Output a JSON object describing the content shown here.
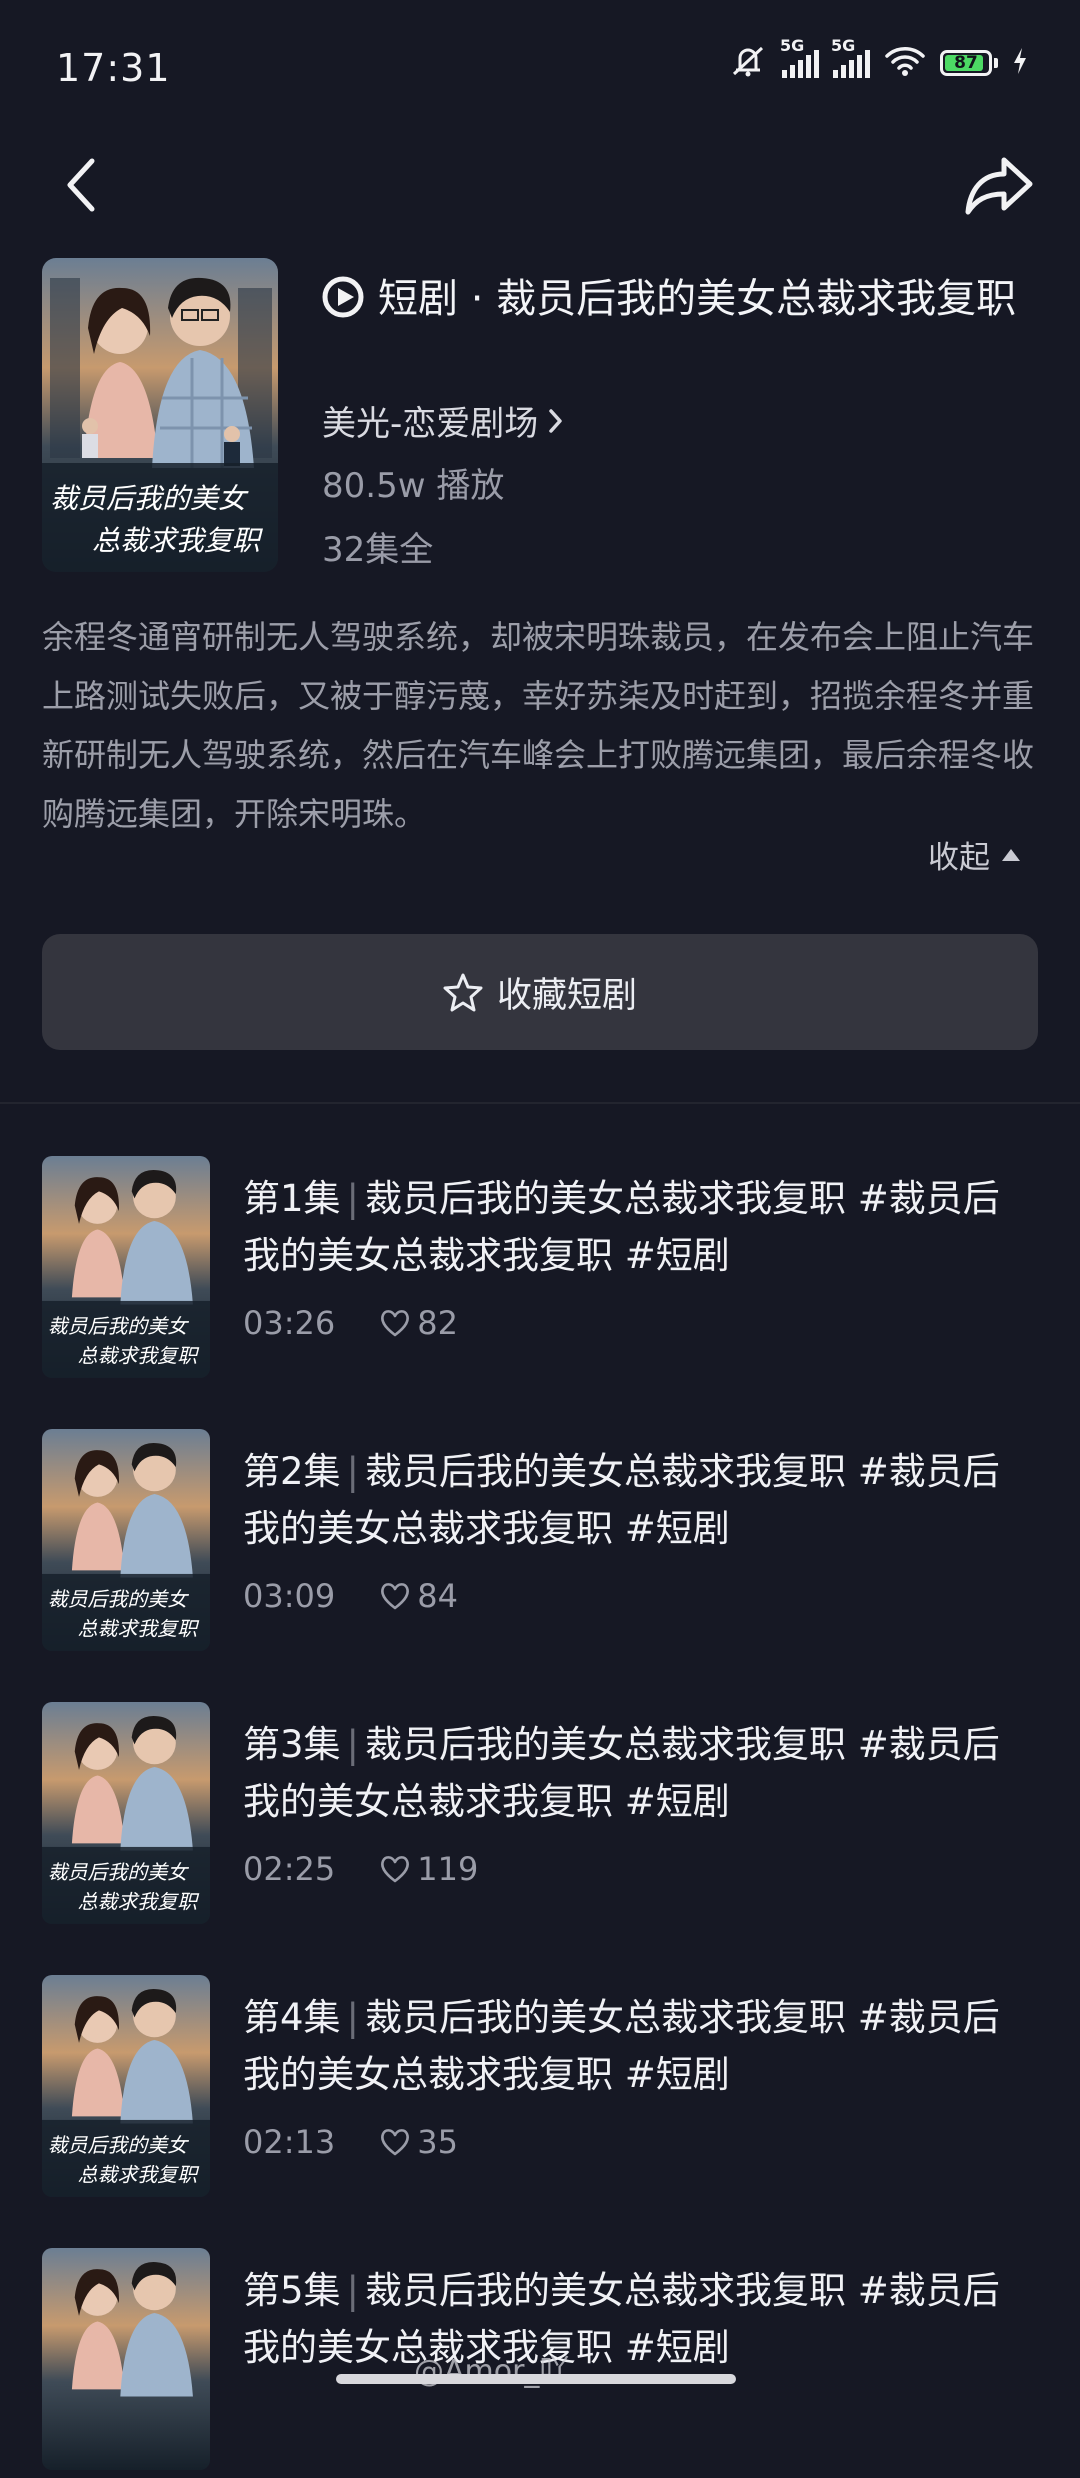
{
  "status_bar": {
    "time": "17:31",
    "net1": "5G",
    "net2": "5G",
    "battery": "87",
    "icons": [
      "mute-icon",
      "signal-icon",
      "signal-icon",
      "wifi-icon",
      "battery-icon",
      "charging-icon"
    ]
  },
  "nav": {
    "back_icon": "chevron-left-icon",
    "share_icon": "share-icon"
  },
  "drama": {
    "type_label": "短剧",
    "dot": "·",
    "title": "裁员后我的美女总裁求我复职",
    "channel": "美光-恋爱剧场",
    "plays": "80.5w 播放",
    "total": "32集全",
    "cover_caption_line1": "裁员后我的美女",
    "cover_caption_line2": "总裁求我复职",
    "description": "余程冬通宵研制无人驾驶系统，却被宋明珠裁员，在发布会上阻止汽车上路测试失败后，又被于醇污蔑，幸好苏柒及时赶到，招揽余程冬并重新研制无人驾驶系统，然后在汽车峰会上打败腾远集团，最后余程冬收购腾远集团，开除宋明珠。",
    "collapse_label": "收起"
  },
  "favorite": {
    "label": "收藏短剧"
  },
  "episodes": [
    {
      "ep": "第1集",
      "title": "裁员后我的美女总裁求我复职 #裁员后我的美女总裁求我复职 #短剧",
      "duration": "03:26",
      "likes": "82"
    },
    {
      "ep": "第2集",
      "title": "裁员后我的美女总裁求我复职 #裁员后我的美女总裁求我复职 #短剧",
      "duration": "03:09",
      "likes": "84"
    },
    {
      "ep": "第3集",
      "title": "裁员后我的美女总裁求我复职 #裁员后我的美女总裁求我复职 #短剧",
      "duration": "02:25",
      "likes": "119"
    },
    {
      "ep": "第4集",
      "title": "裁员后我的美女总裁求我复职 #裁员后我的美女总裁求我复职 #短剧",
      "duration": "02:13",
      "likes": "35"
    },
    {
      "ep": "第5集",
      "title": "裁员后我的美女总裁求我复职 #裁员后我的美女总裁求我复职 #短剧",
      "duration": "",
      "likes": ""
    }
  ],
  "watermark": "@Amor_吖"
}
